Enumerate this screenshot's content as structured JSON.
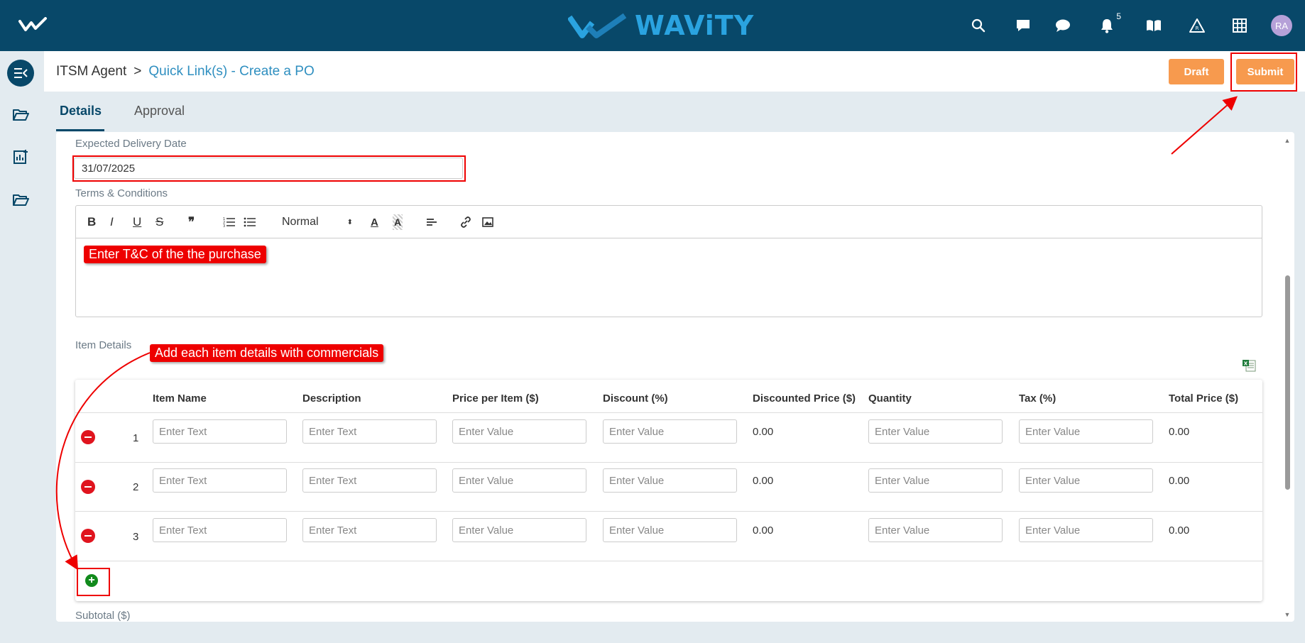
{
  "topbar": {
    "brand": "WAViTY",
    "notification_count": "5",
    "avatar_initials": "RA",
    "bg_color": "#084869",
    "accent_color": "#2aa3e0"
  },
  "breadcrumb": {
    "root": "ITSM Agent",
    "separator": ">",
    "current": "Quick Link(s) - Create a PO"
  },
  "actions": {
    "draft_label": "Draft",
    "submit_label": "Submit",
    "button_color": "#f79a4e"
  },
  "tabs": [
    {
      "label": "Details",
      "active": true
    },
    {
      "label": "Approval",
      "active": false
    }
  ],
  "form": {
    "delivery_date_label": "Expected Delivery Date",
    "delivery_date_value": "31/07/2025",
    "terms_label": "Terms & Conditions",
    "editor_toolbar": {
      "bold": "B",
      "italic": "I",
      "underline": "U",
      "strike": "S",
      "quote": "❞",
      "ordered_list_icon": "ordered-list-icon",
      "bullet_list_icon": "bullet-list-icon",
      "heading_select": "Normal",
      "font_color_icon": "A",
      "highlight_icon": "A"
    },
    "item_details_label": "Item Details",
    "subtotal_label": "Subtotal ($)"
  },
  "items_table": {
    "columns": [
      "Item Name",
      "Description",
      "Price per Item ($)",
      "Discount (%)",
      "Discounted Price ($)",
      "Quantity",
      "Tax (%)",
      "Total Price ($)"
    ],
    "text_placeholder": "Enter Text",
    "value_placeholder": "Enter Value",
    "rows": [
      {
        "num": "1",
        "discounted_price": "0.00",
        "total_price": "0.00"
      },
      {
        "num": "2",
        "discounted_price": "0.00",
        "total_price": "0.00"
      },
      {
        "num": "3",
        "discounted_price": "0.00",
        "total_price": "0.00"
      }
    ]
  },
  "annotations": {
    "terms_callout": "Enter T&C of the the purchase",
    "items_callout": "Add each item details with commercials",
    "highlight_color": "#e00000"
  }
}
